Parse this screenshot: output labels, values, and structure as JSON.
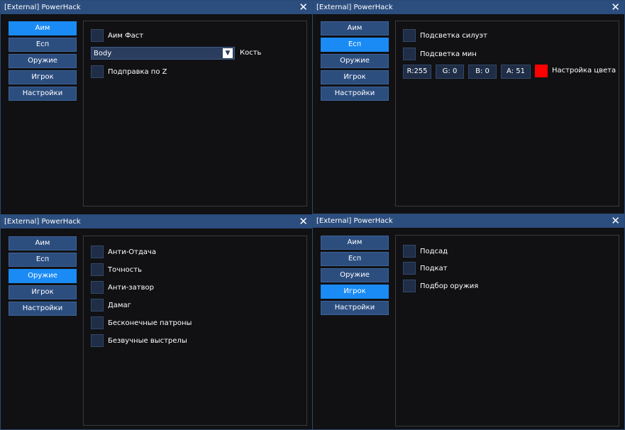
{
  "title": "[External] PowerHack",
  "nav": [
    "Аим",
    "Есп",
    "Оружие",
    "Игрок",
    "Настройки"
  ],
  "aim": {
    "fast_label": "Аим Фаст",
    "bone_value": "Body",
    "bone_label": "Кость",
    "z_label": "Подправка по Z"
  },
  "esp": {
    "silhouette_label": "Подсветка  силуэт",
    "mines_label": "Подсветка  мин",
    "r": "R:255",
    "g": "G:  0",
    "b": "B:  0",
    "a": "A: 51",
    "color_label": "Настройка цвета",
    "swatch_color": "#ff0000"
  },
  "weapon": {
    "items": [
      "Анти-Отдача",
      "Точность",
      "Анти-затвор",
      "Дамаг",
      "Бесконечные патроны",
      "Безвучные выстрелы"
    ]
  },
  "player": {
    "items": [
      "Подсад",
      "Подкат",
      "Подбор оружия"
    ]
  },
  "colors": {
    "titlebar": "#2c4e7f",
    "nav_button": "#2c4e7f",
    "nav_active": "#1a8bf5",
    "background": "#111113",
    "checkbox": "#1f2d46"
  }
}
